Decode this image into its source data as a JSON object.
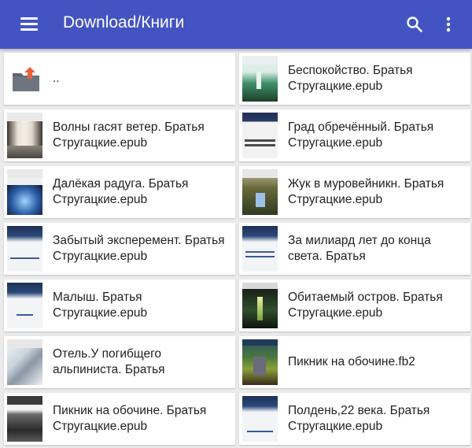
{
  "appbar": {
    "title": "Download/Книги",
    "menu_icon": "menu-icon",
    "search_icon": "search-icon",
    "more_icon": "more-vert-icon",
    "color": "#4354c2"
  },
  "files": [
    {
      "name": "..",
      "icon": "folder-up-icon"
    },
    {
      "name": "Беспокойство. Братья Стругацкие.epub",
      "icon": "book-cover-icon"
    },
    {
      "name": "Волны гасят ветер. Братья Стругацкие.epub",
      "icon": "book-cover-icon"
    },
    {
      "name": "Град обречённый. Братья Стругацкие.epub",
      "icon": "book-cover-icon"
    },
    {
      "name": "Далёкая радуга. Братья Стругацкие.epub",
      "icon": "book-cover-icon"
    },
    {
      "name": "Жук в муровейникн. Братья Стругацкие.epub",
      "icon": "book-cover-icon"
    },
    {
      "name": "Забытый эксперемент. Братья Стругацкие.epub",
      "icon": "book-cover-icon"
    },
    {
      "name": "За милиард лет до конца света.  Братья",
      "icon": "book-cover-icon"
    },
    {
      "name": "Малыш.  Братья Стругацкие.epub",
      "icon": "book-cover-icon"
    },
    {
      "name": "Обитаемый остров.  Братья Стругацкие.epub",
      "icon": "book-cover-icon"
    },
    {
      "name": "Отель.У погибщего альпиниста. Братья",
      "icon": "book-cover-icon"
    },
    {
      "name": "Пикник на обочине.fb2",
      "icon": "book-cover-icon"
    },
    {
      "name": "Пикник на обочине. Братья Стругацкие.epub",
      "icon": "book-cover-icon"
    },
    {
      "name": "Полдень,22 века.  Братья Стругацкие.epub",
      "icon": "book-cover-icon"
    }
  ]
}
